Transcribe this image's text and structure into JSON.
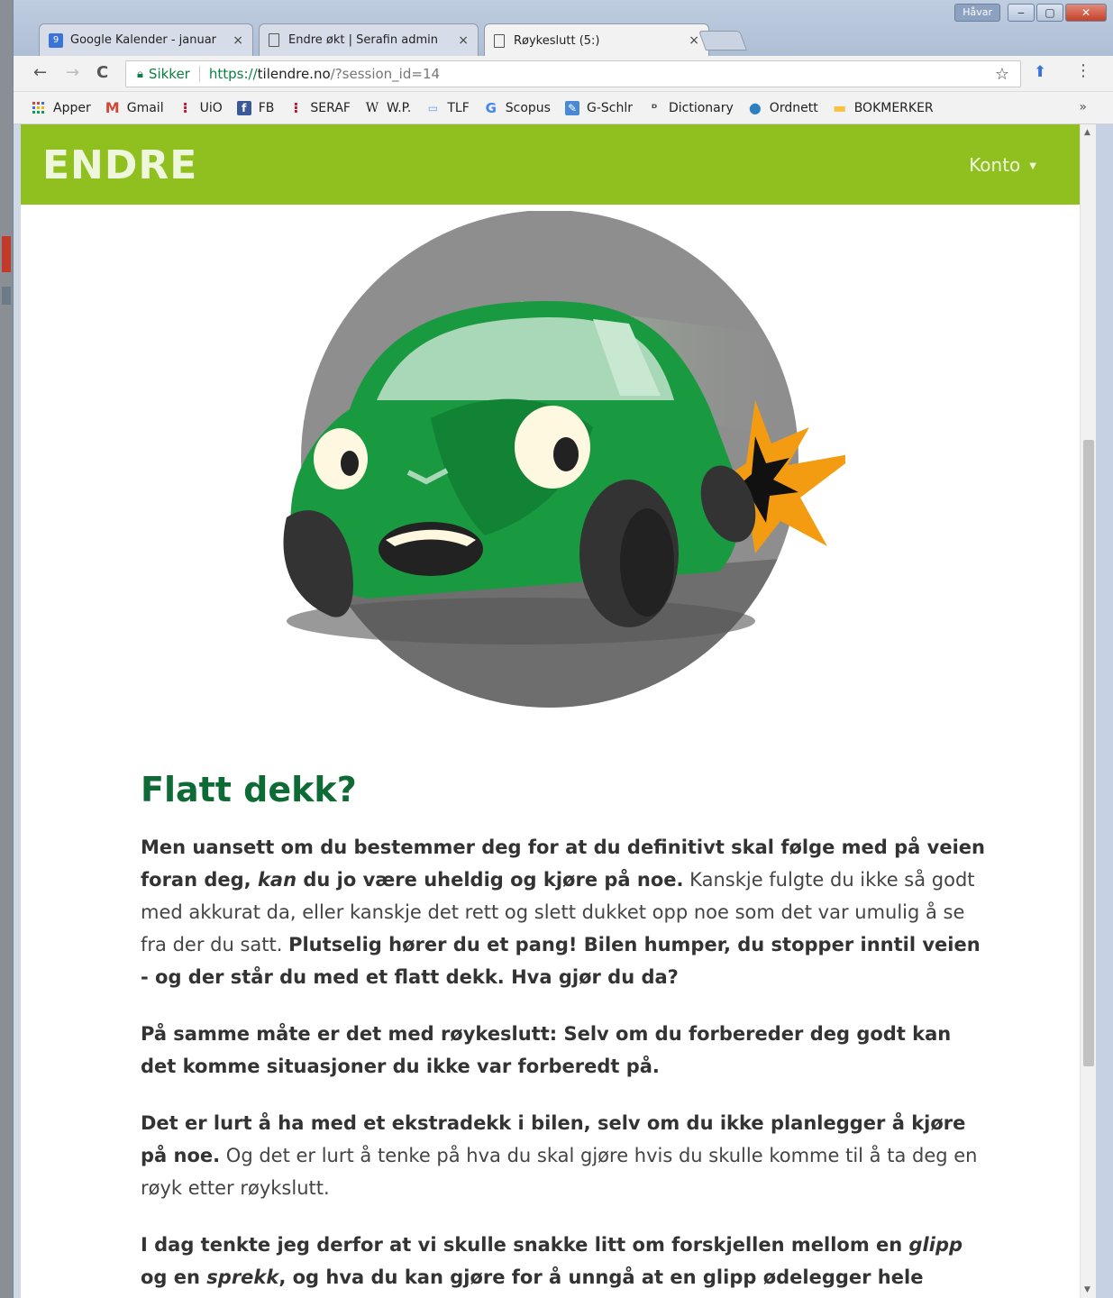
{
  "browser": {
    "tabs": [
      {
        "title": "Google Kalender - januar",
        "close": "×",
        "favicon": "calendar-icon",
        "favicon_text": "9"
      },
      {
        "title": "Endre økt | Serafin admin",
        "close": "×",
        "favicon": "page-icon"
      },
      {
        "title": "Røykeslutt (5:)",
        "close": "×",
        "favicon": "page-icon",
        "active": true
      }
    ],
    "user_chip": "Håvar",
    "window_buttons": {
      "minimize": "‒",
      "maximize": "▢",
      "close": "✕"
    },
    "nav": {
      "back": "←",
      "forward": "→",
      "reload": "C"
    },
    "address": {
      "secure_label": "Sikker",
      "url_scheme": "https://",
      "url_host": "tilendre.no",
      "url_rest": "/?session_id=14"
    },
    "bookmark_star": "☆",
    "menu": "⋮",
    "bookmarks": [
      {
        "label": "Apper",
        "icon": "apps-grid-icon"
      },
      {
        "label": "Gmail",
        "icon": "gmail-icon",
        "glyph": "M"
      },
      {
        "label": "UiO",
        "icon": "uio-icon",
        "glyph": "⁝"
      },
      {
        "label": "FB",
        "icon": "facebook-icon",
        "glyph": "f"
      },
      {
        "label": "SERAF",
        "icon": "seraf-icon",
        "glyph": "⁝"
      },
      {
        "label": "W.P.",
        "icon": "wikipedia-icon",
        "glyph": "W"
      },
      {
        "label": "TLF",
        "icon": "phone-book-icon",
        "glyph": "▭"
      },
      {
        "label": "Scopus",
        "icon": "google-icon",
        "glyph": "G"
      },
      {
        "label": "G-Schlr",
        "icon": "scholar-icon",
        "glyph": "✎"
      },
      {
        "label": "Dictionary",
        "icon": "dictionary-icon",
        "glyph": "ᴰ"
      },
      {
        "label": "Ordnett",
        "icon": "ordnett-icon",
        "glyph": "●"
      },
      {
        "label": "BOKMERKER",
        "icon": "folder-icon",
        "glyph": "▬"
      }
    ],
    "bookmarks_more": "»"
  },
  "site": {
    "logo": "ENDRE",
    "account_label": "Konto",
    "account_caret": "▼",
    "brand_color": "#8fc01f",
    "heading_color": "#0e6b35"
  },
  "article": {
    "title": "Flatt dekk?",
    "p1": {
      "b1": "Men uansett om du bestemmer deg for at du definitivt skal følge med på veien foran deg, ",
      "i1": "kan",
      "b2": " du jo være uheldig og kjøre på noe.",
      "t1": " Kanskje fulgte du ikke så godt med akkurat da, eller kanskje det rett og slett dukket opp noe som det var umulig å se fra der du satt. ",
      "b3": "Plutselig hører du et pang! Bilen humper, du stopper inntil veien - og der står du med et flatt dekk. Hva gjør du da?"
    },
    "p2": {
      "b1": "På samme måte er det med røykeslutt: Selv om du forbereder deg godt kan det komme situasjoner du ikke var forberedt på."
    },
    "p3": {
      "b1": "Det er lurt å ha med et ekstradekk i bilen, selv om du ikke planlegger å kjøre på noe.",
      "t1": " Og det er lurt å tenke på hva du skal gjøre hvis du skulle komme til å ta deg en røyk etter røykslutt."
    },
    "p4": {
      "b1": "I dag tenkte jeg derfor at vi skulle snakke litt om forskjellen mellom en ",
      "i1": "glipp",
      "b2": " og en ",
      "i2": "sprekk",
      "b3": ", og hva du kan gjøre for å unngå at en glipp ødelegger hele røykesluttten din."
    }
  }
}
